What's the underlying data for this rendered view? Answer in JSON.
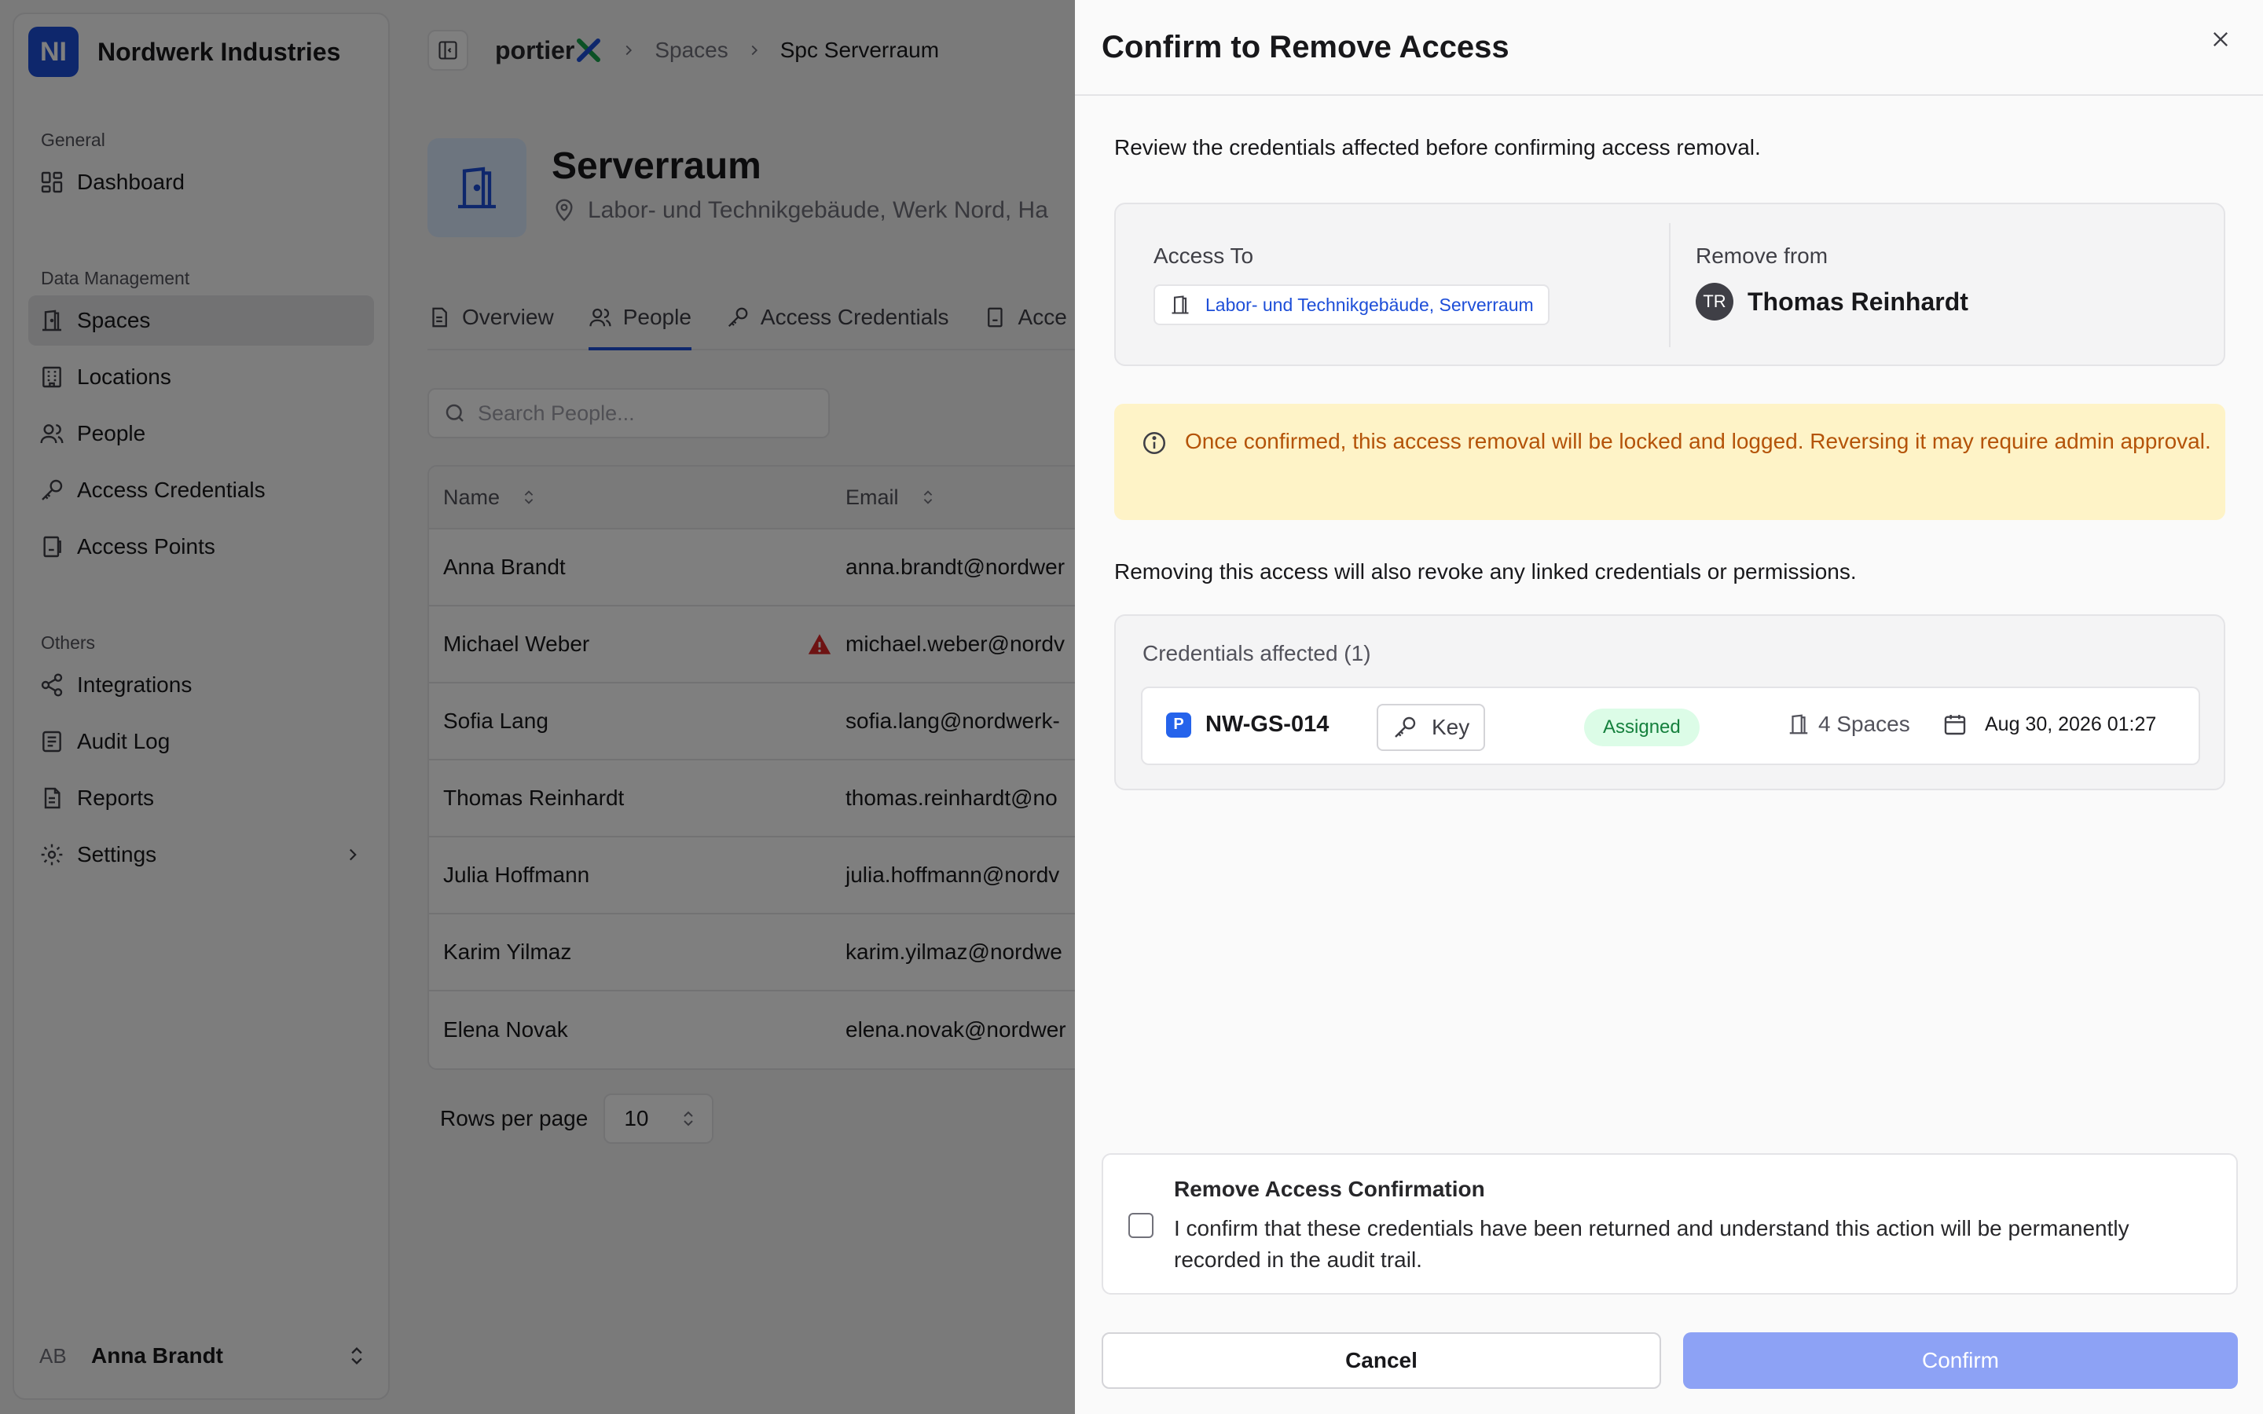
{
  "sidebar": {
    "org_initials": "NI",
    "org_name": "Nordwerk Industries",
    "groups": [
      {
        "heading": "General",
        "items": [
          {
            "label": "Dashboard"
          }
        ]
      },
      {
        "heading": "Data Management",
        "items": [
          {
            "label": "Spaces",
            "active": true
          },
          {
            "label": "Locations"
          },
          {
            "label": "People"
          },
          {
            "label": "Access Credentials"
          },
          {
            "label": "Access Points"
          }
        ]
      },
      {
        "heading": "Others",
        "items": [
          {
            "label": "Integrations"
          },
          {
            "label": "Audit Log"
          },
          {
            "label": "Reports"
          },
          {
            "label": "Settings"
          }
        ]
      }
    ],
    "user": {
      "initials": "AB",
      "name": "Anna Brandt"
    }
  },
  "topbar": {
    "brand": "portier",
    "breadcrumbs": [
      "Spaces",
      "Spc Serverraum"
    ]
  },
  "space": {
    "title": "Serverraum",
    "location": "Labor- und Technikgebäude, Werk Nord, Ha"
  },
  "tabs": [
    {
      "label": "Overview"
    },
    {
      "label": "People",
      "active": true
    },
    {
      "label": "Access Credentials"
    },
    {
      "label": "Acce"
    }
  ],
  "search": {
    "placeholder": "Search People..."
  },
  "table": {
    "columns": [
      "Name",
      "Email"
    ],
    "rows": [
      {
        "name": "Anna Brandt",
        "email": "anna.brandt@nordwer"
      },
      {
        "name": "Michael Weber",
        "email": "michael.weber@nordv",
        "warning": true
      },
      {
        "name": "Sofia Lang",
        "email": "sofia.lang@nordwerk-"
      },
      {
        "name": "Thomas Reinhardt",
        "email": "thomas.reinhardt@no"
      },
      {
        "name": "Julia Hoffmann",
        "email": "julia.hoffmann@nordv"
      },
      {
        "name": "Karim Yilmaz",
        "email": "karim.yilmaz@nordwe"
      },
      {
        "name": "Elena Novak",
        "email": "elena.novak@nordwer"
      }
    ]
  },
  "pagination": {
    "rows_per_page_label": "Rows per page",
    "rows_per_page_value": "10"
  },
  "dialog": {
    "title": "Confirm to Remove Access",
    "intro": "Review the credentials affected before confirming access removal.",
    "access_to_label": "Access To",
    "access_to_value": "Labor- und Technikgebäude, Serverraum",
    "remove_from_label": "Remove from",
    "person_initials": "TR",
    "person_name": "Thomas Reinhardt",
    "warning": "Once confirmed, this access removal will be locked and logged. Reversing it may require admin approval.",
    "revoke_note": "Removing this access will also revoke any linked credentials or permissions.",
    "credentials_heading": "Credentials affected (1)",
    "credential": {
      "badge": "P",
      "id": "NW-GS-014",
      "type": "Key",
      "status": "Assigned",
      "spaces": "4 Spaces",
      "date": "Aug 30, 2026 01:27"
    },
    "confirm_title": "Remove Access Confirmation",
    "confirm_text": "I confirm that these credentials have been returned and understand this action will be permanently recorded in the audit trail.",
    "cancel_label": "Cancel",
    "confirm_label": "Confirm"
  },
  "colors": {
    "accent": "#1d4ed8",
    "confirm_disabled": "#8da2f5",
    "warning_bg": "#fef3c7",
    "warning_text": "#b45309",
    "status_bg": "#dcfce7",
    "status_text": "#15803d"
  }
}
